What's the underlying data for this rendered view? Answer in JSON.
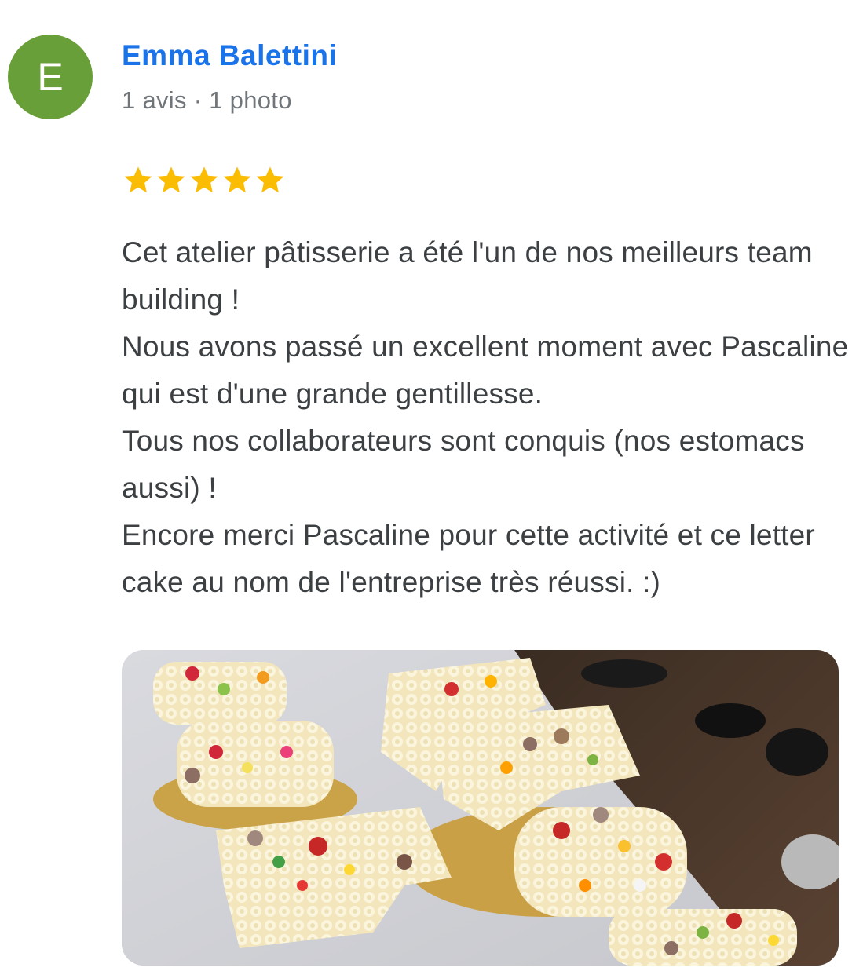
{
  "reviewer": {
    "initial": "E",
    "name": "Emma Balettini",
    "meta": "1 avis · 1 photo",
    "avatar_color": "#689f38"
  },
  "review": {
    "rating": 5,
    "star_color": "#fbbc04",
    "text": "Cet atelier pâtisserie a été l'un de nos meilleurs team building !\nNous avons passé un excellent moment avec Pascaline qui est d'une grande gentillesse.\nTous nos collaborateurs sont conquis (nos estomacs aussi) !\nEncore merci Pascaline pour cette activité et ce letter cake au nom de l'entreprise très réussi. :)"
  },
  "photo": {
    "subject": "letter-cakes-photo"
  },
  "colors": {
    "name_link": "#1a73e8",
    "meta_text": "#70757a",
    "body_text": "#3c4043"
  }
}
